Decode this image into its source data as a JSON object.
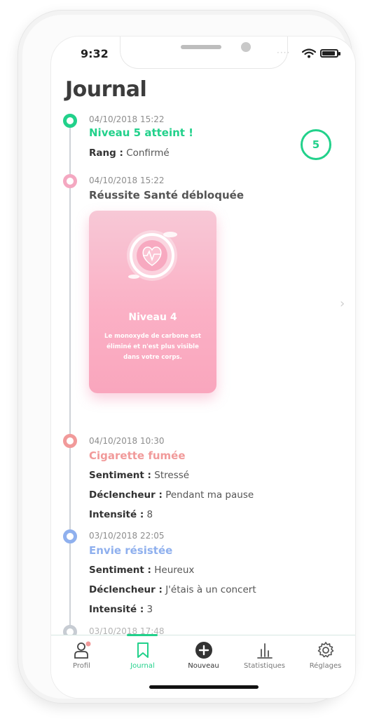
{
  "status_bar": {
    "time": "9:32",
    "signal_dots": "····"
  },
  "page": {
    "title": "Journal"
  },
  "entries": [
    {
      "date": "04/10/2018 15:22",
      "title": "Niveau 5 atteint !",
      "color": "#22d18b",
      "lines": [
        {
          "label": "Rang :",
          "value": "Confirmé"
        }
      ],
      "badge": "5"
    },
    {
      "date": "04/10/2018 15:22",
      "title": "Réussite Santé débloquée",
      "color": "#f4a8c1",
      "card": {
        "title": "Niveau 4",
        "text": "Le monoxyde de carbone est éliminé et n'est plus visible dans votre corps."
      }
    },
    {
      "date": "04/10/2018 10:30",
      "title": "Cigarette fumée",
      "color": "#f19a9a",
      "lines": [
        {
          "label": "Sentiment :",
          "value": "Stressé"
        },
        {
          "label": "Déclencheur :",
          "value": "Pendant ma pause"
        },
        {
          "label": "Intensité :",
          "value": "8"
        }
      ]
    },
    {
      "date": "03/10/2018 22:05",
      "title": "Envie résistée",
      "color": "#8fb0ee",
      "lines": [
        {
          "label": "Sentiment :",
          "value": "Heureux"
        },
        {
          "label": "Déclencheur :",
          "value": "J'étais à un concert"
        },
        {
          "label": "Intensité :",
          "value": "3"
        }
      ]
    },
    {
      "date": "03/10/2018 17:48",
      "color": "#c7ccd3"
    }
  ],
  "tabbar": {
    "active": "Journal",
    "tabs": [
      {
        "label": "Profil",
        "icon": "user-icon"
      },
      {
        "label": "Journal",
        "icon": "bookmark-icon"
      },
      {
        "label": "Nouveau",
        "icon": "plus-circle-icon"
      },
      {
        "label": "Statistiques",
        "icon": "bar-chart-icon"
      },
      {
        "label": "Réglages",
        "icon": "gear-icon"
      }
    ]
  },
  "colors": {
    "accent": "#22d18b",
    "text_dark": "#3c3c3c",
    "text_muted": "#8d8d8d",
    "notification_dot": "#f19a9a"
  }
}
